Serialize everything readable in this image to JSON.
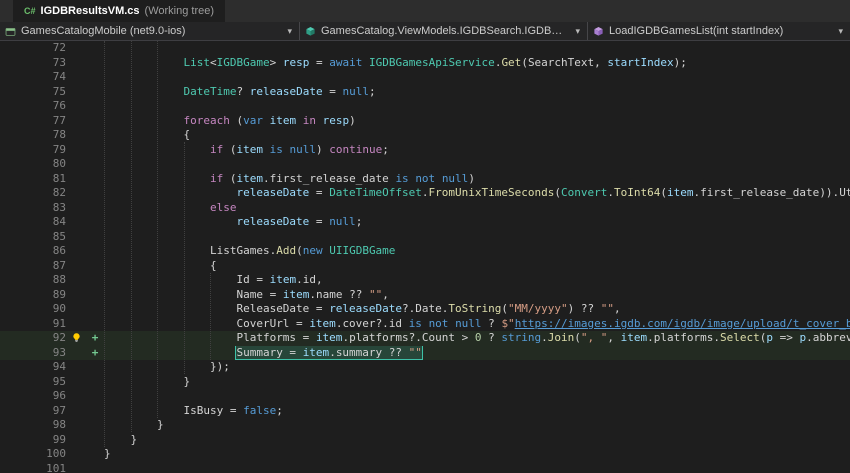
{
  "colors": {
    "editor_background": "#1e1e1e",
    "keyword": "#569cd6",
    "control_keyword": "#c586c0",
    "type": "#4ec9b0",
    "method": "#dcdcaa",
    "variable": "#9cdcfe",
    "string": "#d69d85",
    "number": "#b5cea8",
    "link": "#569cd6",
    "added_line_marker": "#73c991",
    "selection_box": "#3ec1a7",
    "line_number": "#858585"
  },
  "icons": {
    "csharp_file": "C#",
    "chevron_down": "▾",
    "git_added_marker": "+"
  },
  "tab": {
    "file_name": "IGDBResultsVM.cs",
    "suffix": " (Working tree)"
  },
  "breadcrumbs": [
    {
      "label": "GamesCatalogMobile (net9.0-ios)"
    },
    {
      "label": "GamesCatalog.ViewModels.IGDBSearch.IGDBResultsVM"
    },
    {
      "label": "LoadIGDBGamesList(int startIndex)"
    }
  ],
  "editor": {
    "lines": [
      {
        "n": 72,
        "t": []
      },
      {
        "n": 73,
        "t": [
          [
            "p",
            "            "
          ],
          [
            "t",
            "List"
          ],
          [
            "p",
            "<"
          ],
          [
            "t",
            "IGDBGame"
          ],
          [
            "p",
            "> "
          ],
          [
            "v",
            "resp"
          ],
          [
            "p",
            " = "
          ],
          [
            "k",
            "await"
          ],
          [
            "p",
            " "
          ],
          [
            "t",
            "IGDBGamesApiService"
          ],
          [
            "p",
            "."
          ],
          [
            "m",
            "Get"
          ],
          [
            "p",
            "("
          ],
          [
            "f",
            "SearchText"
          ],
          [
            "p",
            ", "
          ],
          [
            "v",
            "startIndex"
          ],
          [
            "p",
            ");"
          ]
        ]
      },
      {
        "n": 74,
        "t": []
      },
      {
        "n": 75,
        "t": [
          [
            "p",
            "            "
          ],
          [
            "t",
            "DateTime"
          ],
          [
            "p",
            "? "
          ],
          [
            "v",
            "releaseDate"
          ],
          [
            "p",
            " = "
          ],
          [
            "k",
            "null"
          ],
          [
            "p",
            ";"
          ]
        ]
      },
      {
        "n": 76,
        "t": []
      },
      {
        "n": 77,
        "t": [
          [
            "p",
            "            "
          ],
          [
            "c",
            "foreach"
          ],
          [
            "p",
            " ("
          ],
          [
            "k",
            "var"
          ],
          [
            "p",
            " "
          ],
          [
            "v",
            "item"
          ],
          [
            "p",
            " "
          ],
          [
            "c",
            "in"
          ],
          [
            "p",
            " "
          ],
          [
            "v",
            "resp"
          ],
          [
            "p",
            ")"
          ]
        ]
      },
      {
        "n": 78,
        "t": [
          [
            "p",
            "            "
          ],
          [
            "p",
            "{"
          ]
        ]
      },
      {
        "n": 79,
        "t": [
          [
            "p",
            "                "
          ],
          [
            "c",
            "if"
          ],
          [
            "p",
            " ("
          ],
          [
            "v",
            "item"
          ],
          [
            "p",
            " "
          ],
          [
            "k",
            "is"
          ],
          [
            "p",
            " "
          ],
          [
            "k",
            "null"
          ],
          [
            "p",
            ") "
          ],
          [
            "c",
            "continue"
          ],
          [
            "p",
            ";"
          ]
        ]
      },
      {
        "n": 80,
        "t": []
      },
      {
        "n": 81,
        "t": [
          [
            "p",
            "                "
          ],
          [
            "c",
            "if"
          ],
          [
            "p",
            " ("
          ],
          [
            "v",
            "item"
          ],
          [
            "p",
            "."
          ],
          [
            "f",
            "first_release_date"
          ],
          [
            "p",
            " "
          ],
          [
            "k",
            "is"
          ],
          [
            "p",
            " "
          ],
          [
            "k",
            "not"
          ],
          [
            "p",
            " "
          ],
          [
            "k",
            "null"
          ],
          [
            "p",
            ")"
          ]
        ]
      },
      {
        "n": 82,
        "t": [
          [
            "p",
            "                    "
          ],
          [
            "v",
            "releaseDate"
          ],
          [
            "p",
            " = "
          ],
          [
            "t",
            "DateTimeOffset"
          ],
          [
            "p",
            "."
          ],
          [
            "m",
            "FromUnixTimeSeconds"
          ],
          [
            "p",
            "("
          ],
          [
            "t",
            "Convert"
          ],
          [
            "p",
            "."
          ],
          [
            "m",
            "ToInt64"
          ],
          [
            "p",
            "("
          ],
          [
            "v",
            "item"
          ],
          [
            "p",
            "."
          ],
          [
            "f",
            "first_release_date"
          ],
          [
            "p",
            "))."
          ],
          [
            "f",
            "UtcDateTime"
          ],
          [
            "p",
            ";"
          ]
        ]
      },
      {
        "n": 83,
        "t": [
          [
            "p",
            "                "
          ],
          [
            "c",
            "else"
          ]
        ]
      },
      {
        "n": 84,
        "t": [
          [
            "p",
            "                    "
          ],
          [
            "v",
            "releaseDate"
          ],
          [
            "p",
            " = "
          ],
          [
            "k",
            "null"
          ],
          [
            "p",
            ";"
          ]
        ]
      },
      {
        "n": 85,
        "t": []
      },
      {
        "n": 86,
        "t": [
          [
            "p",
            "                "
          ],
          [
            "f",
            "ListGames"
          ],
          [
            "p",
            "."
          ],
          [
            "m",
            "Add"
          ],
          [
            "p",
            "("
          ],
          [
            "k",
            "new"
          ],
          [
            "p",
            " "
          ],
          [
            "t",
            "UIIGDBGame"
          ]
        ]
      },
      {
        "n": 87,
        "t": [
          [
            "p",
            "                "
          ],
          [
            "p",
            "{"
          ]
        ]
      },
      {
        "n": 88,
        "t": [
          [
            "p",
            "                    "
          ],
          [
            "f",
            "Id"
          ],
          [
            "p",
            " = "
          ],
          [
            "v",
            "item"
          ],
          [
            "p",
            "."
          ],
          [
            "f",
            "id"
          ],
          [
            "p",
            ","
          ]
        ]
      },
      {
        "n": 89,
        "t": [
          [
            "p",
            "                    "
          ],
          [
            "f",
            "Name"
          ],
          [
            "p",
            " = "
          ],
          [
            "v",
            "item"
          ],
          [
            "p",
            "."
          ],
          [
            "f",
            "name"
          ],
          [
            "p",
            " ?? "
          ],
          [
            "s",
            "\"\""
          ],
          [
            "p",
            ","
          ]
        ]
      },
      {
        "n": 90,
        "t": [
          [
            "p",
            "                    "
          ],
          [
            "f",
            "ReleaseDate"
          ],
          [
            "p",
            " = "
          ],
          [
            "v",
            "releaseDate"
          ],
          [
            "p",
            "?."
          ],
          [
            "f",
            "Date"
          ],
          [
            "p",
            "."
          ],
          [
            "m",
            "ToString"
          ],
          [
            "p",
            "("
          ],
          [
            "s",
            "\"MM/yyyy\""
          ],
          [
            "p",
            ") ?? "
          ],
          [
            "s",
            "\"\""
          ],
          [
            "p",
            ","
          ]
        ]
      },
      {
        "n": 91,
        "t": [
          [
            "p",
            "                    "
          ],
          [
            "f",
            "CoverUrl"
          ],
          [
            "p",
            " = "
          ],
          [
            "v",
            "item"
          ],
          [
            "p",
            "."
          ],
          [
            "f",
            "cover"
          ],
          [
            "p",
            "?."
          ],
          [
            "f",
            "id"
          ],
          [
            "p",
            " "
          ],
          [
            "k",
            "is"
          ],
          [
            "p",
            " "
          ],
          [
            "k",
            "not"
          ],
          [
            "p",
            " "
          ],
          [
            "k",
            "null"
          ],
          [
            "p",
            " ? "
          ],
          [
            "s",
            "$\""
          ],
          [
            "u",
            "https://images.igdb.com/igdb/image/upload/t_cover_big/"
          ]
        ]
      },
      {
        "n": 92,
        "added": true,
        "bulb": true,
        "t": [
          [
            "p",
            "                    "
          ],
          [
            "f",
            "Platforms"
          ],
          [
            "p",
            " = "
          ],
          [
            "v",
            "item"
          ],
          [
            "p",
            "."
          ],
          [
            "f",
            "platforms"
          ],
          [
            "p",
            "?."
          ],
          [
            "f",
            "Count"
          ],
          [
            "p",
            " > "
          ],
          [
            "n",
            "0"
          ],
          [
            "p",
            " ? "
          ],
          [
            "k",
            "string"
          ],
          [
            "p",
            "."
          ],
          [
            "m",
            "Join"
          ],
          [
            "p",
            "("
          ],
          [
            "s",
            "\", \""
          ],
          [
            "p",
            ", "
          ],
          [
            "v",
            "item"
          ],
          [
            "p",
            "."
          ],
          [
            "f",
            "platforms"
          ],
          [
            "p",
            "."
          ],
          [
            "m",
            "Select"
          ],
          [
            "p",
            "("
          ],
          [
            "v",
            "p"
          ],
          [
            "p",
            " => "
          ],
          [
            "v",
            "p"
          ],
          [
            "p",
            "."
          ],
          [
            "f",
            "abbreviation"
          ]
        ]
      },
      {
        "n": 93,
        "added": true,
        "box": 1,
        "t": [
          [
            "p",
            "                    "
          ],
          [
            "f",
            "Summary"
          ],
          [
            "p",
            " = "
          ],
          [
            "v",
            "item"
          ],
          [
            "p",
            "."
          ],
          [
            "f",
            "summary"
          ],
          [
            "p",
            " ?? "
          ],
          [
            "s",
            "\"\""
          ]
        ]
      },
      {
        "n": 94,
        "t": [
          [
            "p",
            "                "
          ],
          [
            "p",
            "});"
          ]
        ]
      },
      {
        "n": 95,
        "t": [
          [
            "p",
            "            "
          ],
          [
            "p",
            "}"
          ]
        ]
      },
      {
        "n": 96,
        "t": []
      },
      {
        "n": 97,
        "t": [
          [
            "p",
            "            "
          ],
          [
            "f",
            "IsBusy"
          ],
          [
            "p",
            " = "
          ],
          [
            "k",
            "false"
          ],
          [
            "p",
            ";"
          ]
        ]
      },
      {
        "n": 98,
        "t": [
          [
            "p",
            "        "
          ],
          [
            "p",
            "}"
          ]
        ]
      },
      {
        "n": 99,
        "t": [
          [
            "p",
            "    "
          ],
          [
            "p",
            "}"
          ]
        ]
      },
      {
        "n": 100,
        "t": [
          [
            "p",
            "}"
          ]
        ]
      },
      {
        "n": 101,
        "t": []
      }
    ]
  }
}
